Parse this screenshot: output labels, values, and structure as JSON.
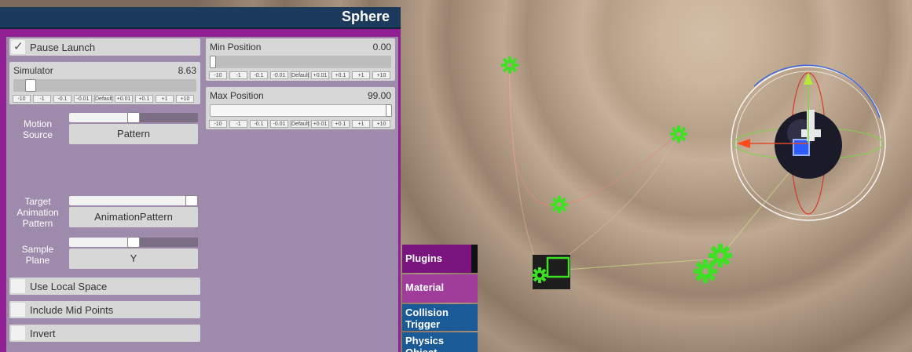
{
  "panel": {
    "title": "Sphere",
    "pause_launch": {
      "label": "Pause Launch",
      "checked": true
    },
    "simulator": {
      "label": "Simulator",
      "value": "8.63",
      "fraction": 0.07
    },
    "min_position": {
      "label": "Min Position",
      "value": "0.00",
      "fraction": 0.0
    },
    "max_position": {
      "label": "Max Position",
      "value": "99.00",
      "fraction": 1.0
    },
    "step_buttons": [
      "-10",
      "-1",
      "-0.1",
      "-0.01",
      "Default",
      "+0.01",
      "+0.1",
      "+1",
      "+10"
    ],
    "motion_source": {
      "label": "Motion Source",
      "value": "Pattern",
      "slider_fraction": 0.5
    },
    "target_animation_pattern": {
      "label": "Target Animation Pattern",
      "value": "AnimationPattern",
      "slider_fraction": 1.0
    },
    "sample_plane": {
      "label": "Sample Plane",
      "value": "Y",
      "slider_fraction": 0.5
    },
    "use_local_space": {
      "label": "Use Local Space",
      "checked": false
    },
    "include_mid_points": {
      "label": "Include Mid Points",
      "checked": false
    },
    "invert": {
      "label": "Invert",
      "checked": false
    }
  },
  "tabs": [
    {
      "label": "Plugins",
      "color": "#7a1580"
    },
    {
      "label": "Material",
      "color": "#a03c9a"
    },
    {
      "label": "Collision Trigger",
      "color": "#1a5a96"
    },
    {
      "label": "Physics Object",
      "color": "#1a5a96"
    }
  ],
  "scene": {
    "marker_icon": "gear-icon",
    "marker_color": "#3ee024",
    "gizmo_icon": "rotate-gizmo-icon"
  }
}
